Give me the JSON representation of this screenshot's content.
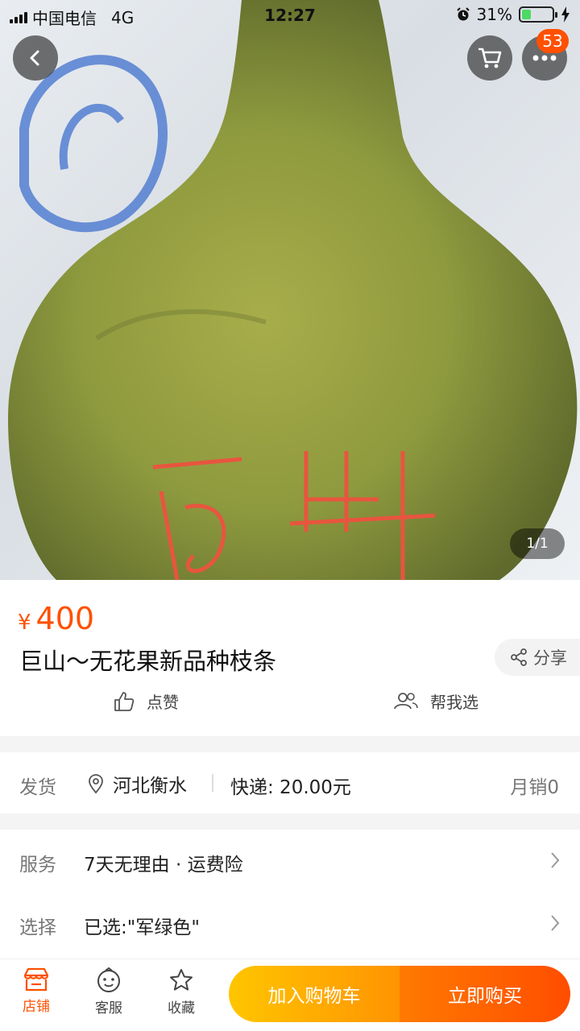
{
  "status_bar": {
    "carrier": "中国电信",
    "network": "4G",
    "time": "12:27",
    "battery_percent": "31%",
    "battery_level": 0.31
  },
  "nav": {
    "cart_badge": "53",
    "image_counter": "1/1"
  },
  "product": {
    "currency": "¥",
    "price": "400",
    "title": "巨山～无花果新品种枝条",
    "share_label": "分享",
    "like_label": "点赞",
    "help_choose_label": "帮我选"
  },
  "shipping": {
    "label": "发货",
    "location": "河北衡水",
    "fee": "快递: 20.00元",
    "monthly_sales": "月销0"
  },
  "services": [
    {
      "label": "服务",
      "value": "7天无理由 · 运费险"
    },
    {
      "label": "选择",
      "value": "已选:\"军绿色\""
    }
  ],
  "bottom_bar": {
    "shop_label": "店铺",
    "service_label": "客服",
    "favorite_label": "收藏",
    "add_to_cart_label": "加入购物车",
    "buy_now_label": "立即购买"
  },
  "colors": {
    "accent": "#ff5000",
    "cart_gradient": [
      "#ffc500",
      "#ff9402"
    ],
    "buy_gradient": [
      "#ff7a00",
      "#ff4d00"
    ]
  }
}
